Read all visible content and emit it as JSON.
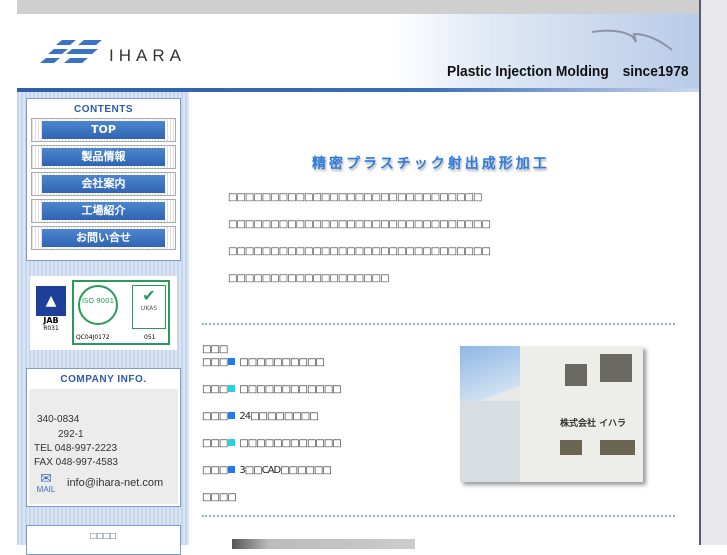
{
  "header": {
    "logo_text": "IHARA",
    "tagline": "Plastic Injection Molding　since1978"
  },
  "sidebar": {
    "contents_title": "CONTENTS",
    "nav": [
      {
        "label": "TOP"
      },
      {
        "label": "製品情報"
      },
      {
        "label": "会社案内"
      },
      {
        "label": "工場紹介"
      },
      {
        "label": "お問い合せ"
      }
    ],
    "certs": {
      "jab": "JAB",
      "jab_code": "R031",
      "iso": "ISO 9001",
      "iso_code": "QC04J0172",
      "ukas": "UKAS",
      "ukas_code": "051"
    },
    "company_title": "COMPANY INFO.",
    "company": {
      "zip": "340-0834",
      "address": "292-1",
      "tel": "TEL 048-997-2223",
      "fax": "FAX 048-997-4583",
      "mail_label": "MAIL",
      "email": "info@ihara-net.com"
    },
    "bottom_title": "□□□□"
  },
  "main": {
    "title": "精密プラスチック射出成形加工",
    "paragraphs": [
      "□□□□□□□□□□□□□□□□□□□□□□□□□□□□□□",
      "□□□□□□□□□□□□□□□□□□□□□□□□□□□□□□□",
      "□□□□□□□□□□□□□□□□□□□□□□□□□□□□□□□",
      "□□□□□□□□□□□□□□□□□□□"
    ],
    "features_title": "□□□",
    "features": [
      {
        "prefix": "□□□",
        "text": "□□□□□□□□□□",
        "color": "#1e7cf0"
      },
      {
        "prefix": "□□□",
        "text": "□□□□□□□□□□□□",
        "color": "#22d4e0"
      },
      {
        "prefix": "□□□",
        "text": "24□□□□□□□□",
        "color": "#1e7cf0"
      },
      {
        "prefix": "□□□",
        "text": "□□□□□□□□□□□□",
        "color": "#22d4e0"
      },
      {
        "prefix": "□□□",
        "text": "3□□CAD□□□□□□",
        "color": "#1e7cf0"
      }
    ],
    "features_footer": "□□□□",
    "photo_sign": "株式会社 イハラ"
  }
}
